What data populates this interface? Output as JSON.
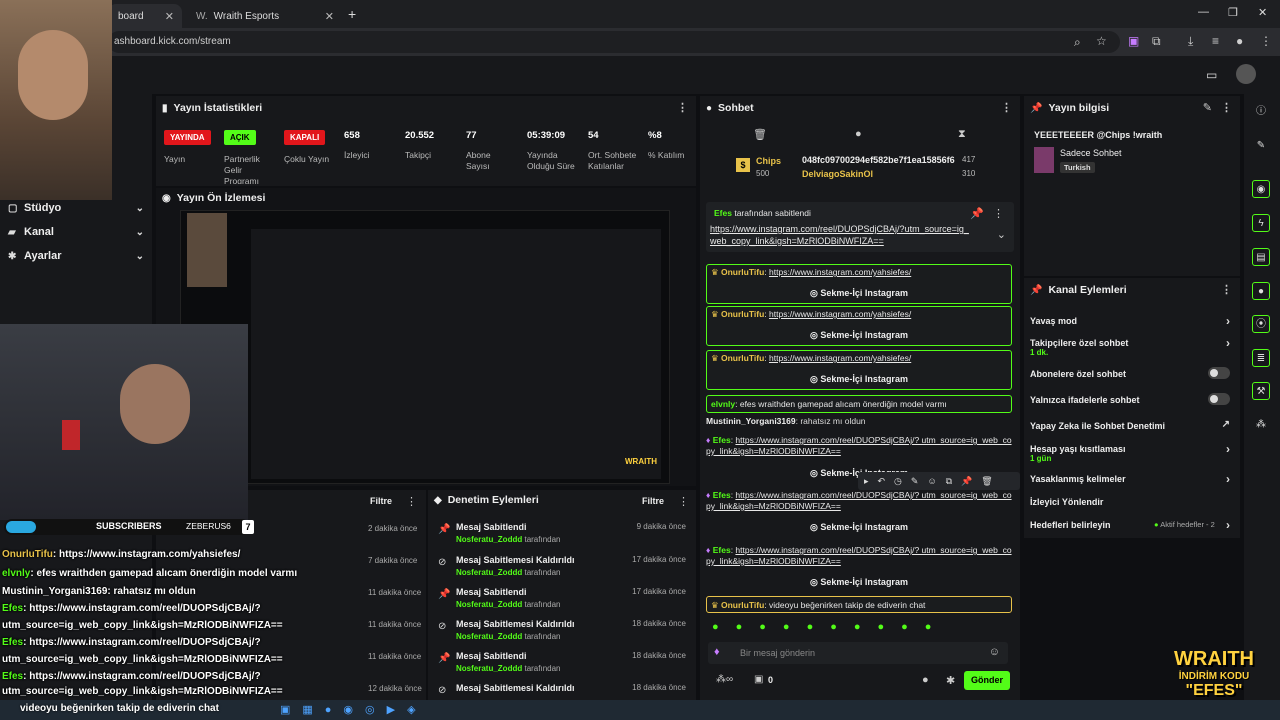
{
  "browser": {
    "tabs": [
      {
        "label": "board"
      },
      {
        "label": "Wraith Esports"
      }
    ],
    "new_tab": "+",
    "url": "ashboard.kick.com/stream"
  },
  "sidebar": {
    "items": [
      {
        "label": "Stüdyo"
      },
      {
        "label": "Kanal"
      },
      {
        "label": "Ayarlar"
      }
    ]
  },
  "stats": {
    "title": "Yayın İstatistikleri",
    "badges": [
      "YAYINDA",
      "AÇIK",
      "KAPALI"
    ],
    "badge_labels": [
      "Yayın",
      "Partnerlik Gelir Programı",
      "Çoklu Yayın"
    ],
    "items": [
      {
        "value": "658",
        "label": "İzleyici"
      },
      {
        "value": "20.552",
        "label": "Takipçi"
      },
      {
        "value": "77",
        "label": "Abone Sayısı"
      },
      {
        "value": "05:39:09",
        "label": "Yayında Olduğu Süre"
      },
      {
        "value": "54",
        "label": "Ort. Sohbete Katılanlar"
      },
      {
        "value": "%8",
        "label": "% Katılım"
      }
    ]
  },
  "preview": {
    "title": "Yayın Ön İzlemesi"
  },
  "mod": {
    "title": "Denetim Eylemleri",
    "filter": "Filtre",
    "rows": [
      {
        "title": "Mesaj Sabitlendi",
        "user": "Nosferatu_Zoddd",
        "suffix": "tarafından",
        "ago": "9 dakika önce"
      },
      {
        "title": "Mesaj Sabitlemesi Kaldırıldı",
        "user": "Nosferatu_Zoddd",
        "suffix": "tarafından",
        "ago": "17 dakika önce"
      },
      {
        "title": "Mesaj Sabitlendi",
        "user": "Nosferatu_Zoddd",
        "suffix": "tarafından",
        "ago": "17 dakika önce"
      },
      {
        "title": "Mesaj Sabitlemesi Kaldırıldı",
        "user": "Nosferatu_Zoddd",
        "suffix": "tarafından",
        "ago": "18 dakika önce"
      },
      {
        "title": "Mesaj Sabitlendi",
        "user": "Nosferatu_Zoddd",
        "suffix": "tarafından",
        "ago": "18 dakika önce"
      },
      {
        "title": "Mesaj Sabitlemesi Kaldırıldı",
        "user": "",
        "suffix": "",
        "ago": "18 dakika önce"
      }
    ]
  },
  "left_list": {
    "filter": "Filtre",
    "agos": [
      "2 dakika önce",
      "7 dakika önce",
      "11 dakika önce",
      "11 dakika önce",
      "11 dakika önce",
      "12 dakika önce"
    ]
  },
  "chat": {
    "title": "Sohbet",
    "chips_label": "Chips",
    "chips_value": "500",
    "top_id": "048fc09700294ef582be7f1ea15856f6",
    "top_id_count": "417",
    "top_user": "DelviagoSakinOl",
    "top_user_count": "310",
    "pinned_by": "Efes",
    "pinned_suffix": "tarafından sabitlendi",
    "pinned_link": "https://www.instagram.com/reel/DUOPSdjCBAj/?utm_source=ig_web_copy_link&igsh=MzRlODBiNWFIZA==",
    "instagram_btn": "Sekme-İçi Instagram",
    "messages": [
      {
        "user": "OnurluTifu",
        "text": "https://www.instagram.com/yahsiefes/"
      },
      {
        "user": "OnurluTifu",
        "text": "https://www.instagram.com/yahsiefes/"
      },
      {
        "user": "OnurluTifu",
        "text": "https://www.instagram.com/yahsiefes/"
      },
      {
        "user": "elvnly",
        "text": "efes wraithden gamepad alıcam önerdiğin model varmı"
      },
      {
        "user": "Mustinin_Yorgani3169",
        "text": "rahatsız mı oldun"
      },
      {
        "user": "Efes",
        "text": "https://www.instagram.com/reel/DUOPSdjCBAj/? utm_source=ig_web_copy_link&igsh=MzRlODBiNWFIZA=="
      },
      {
        "user": "Efes",
        "text": "https://www.instagram.com/reel/DUOPSdjCBAj/? utm_source=ig_web_copy_link&igsh=MzRlODBiNWFIZA=="
      },
      {
        "user": "Efes",
        "text": "https://www.instagram.com/reel/DUOPSdjCBAj/? utm_source=ig_web_copy_link&igsh=MzRlODBiNWFIZA=="
      },
      {
        "user": "OnurluTifu",
        "text": "videoyu beğenirken takip de ediverin chat"
      }
    ],
    "input_placeholder": "Bir mesaj gönderin",
    "points": "0",
    "send": "Gönder"
  },
  "info": {
    "title": "Yayın bilgisi",
    "stream_title": "YEEETEEEER @Chips !wraith",
    "category": "Sadece Sohbet",
    "tag": "Turkish"
  },
  "actions": {
    "title": "Kanal Eylemleri",
    "items": [
      {
        "label": "Yavaş mod",
        "sub": ""
      },
      {
        "label": "Takipçilere özel sohbet",
        "sub": "1 dk."
      },
      {
        "label": "Abonelere özel sohbet",
        "sub": ""
      },
      {
        "label": "Yalnızca ifadelerle sohbet",
        "sub": ""
      },
      {
        "label": "Yapay Zeka ile Sohbet Denetimi",
        "sub": ""
      },
      {
        "label": "Hesap yaşı kısıtlaması",
        "sub": "1 gün"
      },
      {
        "label": "Yasaklanmış kelimeler",
        "sub": ""
      },
      {
        "label": "İzleyici Yönlendir",
        "sub": ""
      },
      {
        "label": "Hedefleri belirleyin",
        "sub": ""
      }
    ],
    "goals_badge": "Aktif hedefler - 2"
  },
  "overlay": {
    "subs_label": "SUBSCRIBERS",
    "subs_user": "ZEBERUS6",
    "subs_count": "7",
    "lines": [
      {
        "user": "OnurluTifu",
        "text": ": https://www.instagram.com/yahsiefes/"
      },
      {
        "user": "elvnly",
        "text": ": efes wraithden gamepad alıcam önerdiğin model varmı"
      },
      {
        "user": "Mustinin_Yorgani3169",
        "text": ": rahatsız mı oldun"
      },
      {
        "user": "Efes",
        "text": ": https://www.instagram.com/reel/DUOPSdjCBAj/?"
      },
      {
        "user": "",
        "text": "utm_source=ig_web_copy_link&igsh=MzRlODBiNWFIZA=="
      },
      {
        "user": "Efes",
        "text": ": https://www.instagram.com/reel/DUOPSdjCBAj/?"
      },
      {
        "user": "",
        "text": "utm_source=ig_web_copy_link&igsh=MzRlODBiNWFIZA=="
      },
      {
        "user": "Efes",
        "text": ": https://www.instagram.com/reel/DUOPSdjCBAj/?"
      },
      {
        "user": "",
        "text": "utm_source=ig_web_copy_link&igsh=MzRlODBiNWFIZA=="
      }
    ],
    "bottom": "videoyu beğenirken takip de ediverin chat",
    "brand1": "WRAITH",
    "brand2": "İNDİRİM KODU",
    "brand3": "\"EFES\""
  },
  "colors": {
    "kick_green": "#53fc18",
    "live_red": "#e2161b",
    "gold": "#e8c24a"
  }
}
